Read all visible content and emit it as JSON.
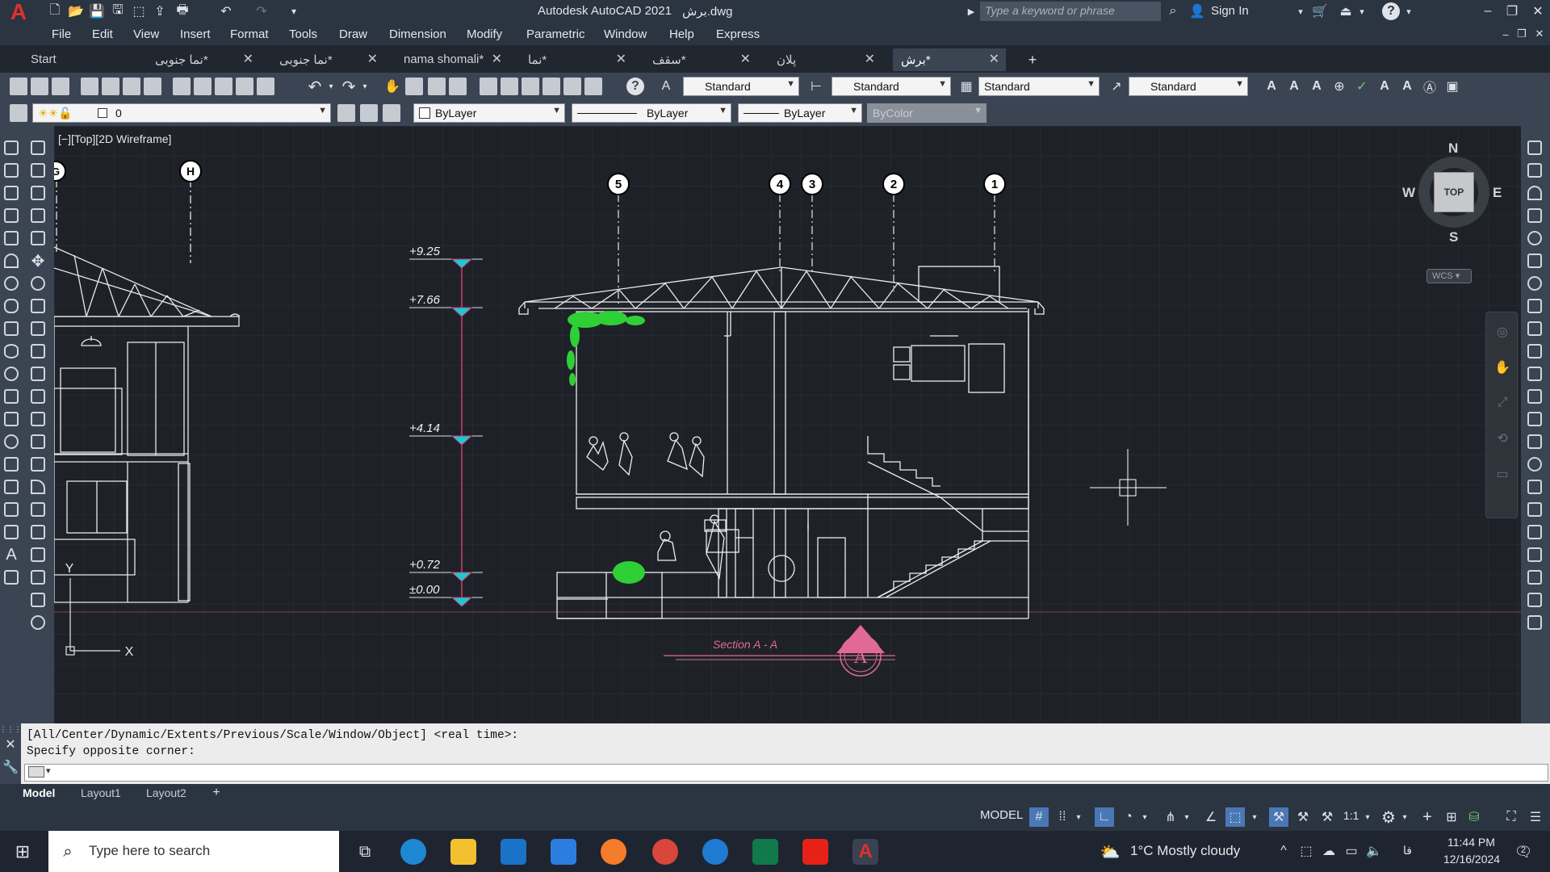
{
  "app": {
    "title": "Autodesk AutoCAD 2021",
    "file": "برش.dwg",
    "search_placeholder": "Type a keyword or phrase",
    "sign_in": "Sign In"
  },
  "menu": [
    "File",
    "Edit",
    "View",
    "Insert",
    "Format",
    "Tools",
    "Draw",
    "Dimension",
    "Modify",
    "Parametric",
    "Window",
    "Help",
    "Express"
  ],
  "tabs": [
    {
      "label": "Start"
    },
    {
      "label": "نما جنوبی*"
    },
    {
      "label": "نما جنوبی*"
    },
    {
      "label": "nama shomali*"
    },
    {
      "label": "نما*"
    },
    {
      "label": "سقف*"
    },
    {
      "label": "پلان"
    },
    {
      "label": "برش*"
    }
  ],
  "styles": {
    "text": "Standard",
    "dim": "Standard",
    "table": "Standard",
    "mleader": "Standard"
  },
  "layers": {
    "current": "0",
    "color": "ByLayer",
    "linetype": "ByLayer",
    "lineweight": "ByLayer",
    "plotstyle": "ByColor"
  },
  "viewport": {
    "label": "[−][Top][2D Wireframe]",
    "viewcube": {
      "n": "N",
      "s": "S",
      "e": "E",
      "w": "W",
      "top": "TOP",
      "wcs": "WCS"
    }
  },
  "drawing": {
    "axes": [
      "G",
      "H",
      "5",
      "4",
      "3",
      "2",
      "1"
    ],
    "levels": [
      "+9.25",
      "+7.66",
      "+4.14",
      "+0.72",
      "±0.00"
    ],
    "section_title": "Section  A - A",
    "section_mark": "A",
    "ucs": {
      "x": "X",
      "y": "Y"
    }
  },
  "command": {
    "history": [
      "[All/Center/Dynamic/Extents/Previous/Scale/Window/Object] <real time>:",
      "Specify opposite corner:"
    ]
  },
  "layouts": [
    "Model",
    "Layout1",
    "Layout2"
  ],
  "status": {
    "model": "MODEL",
    "scale": "1:1"
  },
  "taskbar": {
    "search": "Type here to search",
    "weather": "1°C  Mostly cloudy",
    "time": "11:44 PM",
    "date": "12/16/2024",
    "lang": "فا",
    "notif": "2"
  }
}
